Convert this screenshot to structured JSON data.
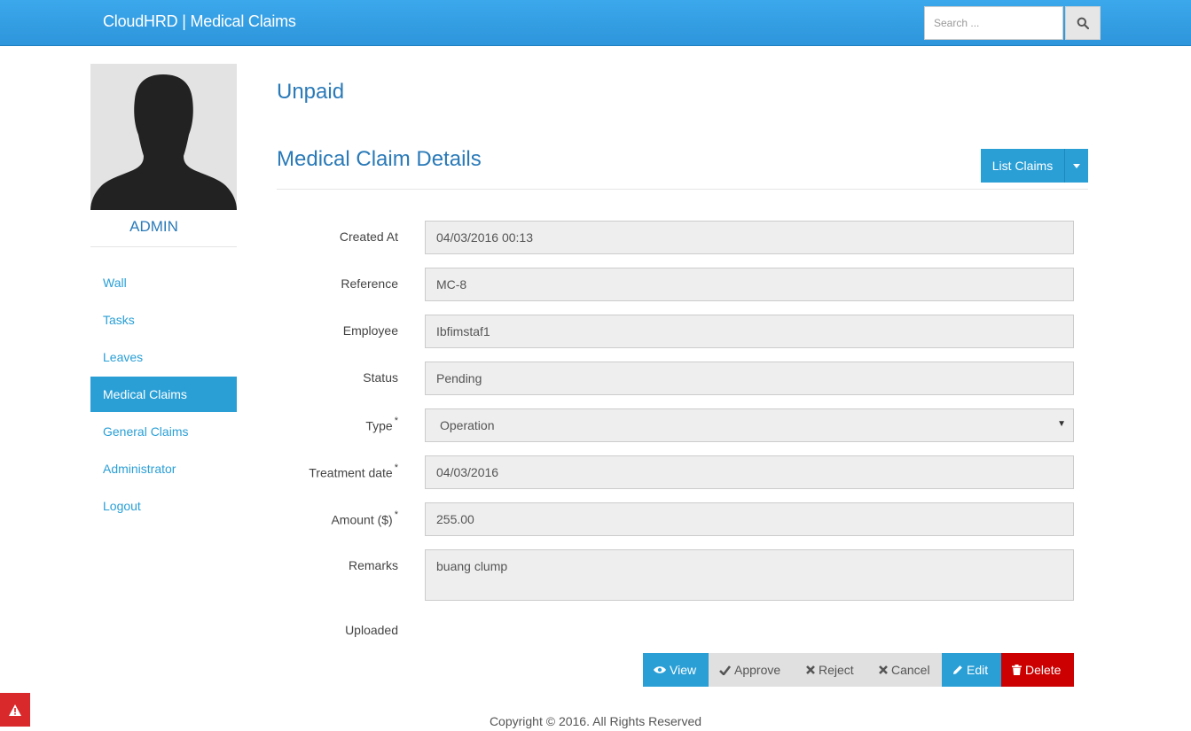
{
  "navbar": {
    "brand": "CloudHRD | Medical Claims",
    "search_placeholder": "Search ...",
    "search_icon": "search-icon"
  },
  "sidebar": {
    "username": "ADMIN",
    "items": [
      {
        "label": "Wall",
        "active": false
      },
      {
        "label": "Tasks",
        "active": false
      },
      {
        "label": "Leaves",
        "active": false
      },
      {
        "label": "Medical Claims",
        "active": true
      },
      {
        "label": "General Claims",
        "active": false
      },
      {
        "label": "Administrator",
        "active": false
      },
      {
        "label": "Logout",
        "active": false
      }
    ]
  },
  "main": {
    "status_heading": "Unpaid",
    "title": "Medical Claim Details",
    "list_button": "List Claims",
    "fields": {
      "created_at": {
        "label": "Created At",
        "value": "04/03/2016 00:13"
      },
      "reference": {
        "label": "Reference",
        "value": "MC-8"
      },
      "employee": {
        "label": "Employee",
        "value": "Ibfimstaf1"
      },
      "status": {
        "label": "Status",
        "value": "Pending"
      },
      "type": {
        "label": "Type",
        "value": "Operation",
        "required": "*"
      },
      "treatment_date": {
        "label": "Treatment date",
        "value": "04/03/2016",
        "required": "*"
      },
      "amount": {
        "label": "Amount ($)",
        "value": "255.00",
        "required": "*"
      },
      "remarks": {
        "label": "Remarks",
        "value": "buang clump"
      },
      "uploaded": {
        "label": "Uploaded"
      }
    },
    "actions": {
      "view": "View",
      "approve": "Approve",
      "reject": "Reject",
      "cancel": "Cancel",
      "edit": "Edit",
      "delete": "Delete"
    }
  },
  "footer": {
    "copyright": "Copyright © 2016. All Rights Reserved"
  },
  "colors": {
    "primary": "#2a9fd6",
    "heading": "#2a7ab8",
    "danger": "#cc0000",
    "navbar": "#3ca8ec"
  }
}
